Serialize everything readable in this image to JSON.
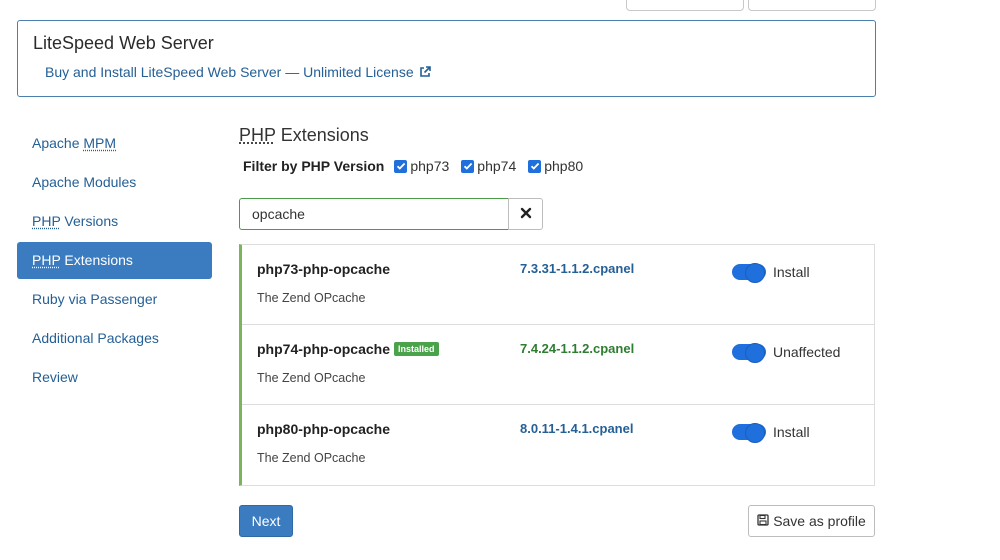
{
  "panel": {
    "title": "LiteSpeed Web Server",
    "link": "Buy and Install LiteSpeed Web Server — Unlimited License"
  },
  "sidebar": {
    "items": [
      {
        "label_pre": "Apache ",
        "abbr": "MPM",
        "label_post": ""
      },
      {
        "label_pre": "Apache Modules",
        "abbr": "",
        "label_post": ""
      },
      {
        "label_pre": "",
        "abbr": "PHP",
        "label_post": " Versions"
      },
      {
        "label_pre": "",
        "abbr": "PHP",
        "label_post": " Extensions",
        "active": true
      },
      {
        "label_pre": "Ruby via Passenger",
        "abbr": "",
        "label_post": ""
      },
      {
        "label_pre": "Additional Packages",
        "abbr": "",
        "label_post": ""
      },
      {
        "label_pre": "Review",
        "abbr": "",
        "label_post": ""
      }
    ]
  },
  "main": {
    "title_abbr": "PHP",
    "title_rest": " Extensions",
    "filter_label": "Filter by PHP Version",
    "filters": [
      {
        "label": "php73",
        "checked": true
      },
      {
        "label": "php74",
        "checked": true
      },
      {
        "label": "php80",
        "checked": true
      }
    ],
    "search_value": "opcache"
  },
  "packages": [
    {
      "name": "php73-php-opcache",
      "badge": "",
      "desc": "The Zend OPcache",
      "version": "7.3.31-1.1.2.cpanel",
      "version_color": "blue",
      "action": "Install",
      "toggle_on": true
    },
    {
      "name": "php74-php-opcache",
      "badge": "Installed",
      "desc": "The Zend OPcache",
      "version": "7.4.24-1.1.2.cpanel",
      "version_color": "green",
      "action": "Unaffected",
      "toggle_on": true
    },
    {
      "name": "php80-php-opcache",
      "badge": "",
      "desc": "The Zend OPcache",
      "version": "8.0.11-1.4.1.cpanel",
      "version_color": "blue",
      "action": "Install",
      "toggle_on": true
    }
  ],
  "footer": {
    "next_label": "Next",
    "save_label": "Save as profile"
  },
  "icons": {
    "external_link": "external-link-icon",
    "clear": "close-icon",
    "save": "save-icon"
  },
  "colors": {
    "accent": "#3b7bbf",
    "link": "#245f96",
    "success": "#4aa34a",
    "toggle": "#1f6fdc"
  }
}
